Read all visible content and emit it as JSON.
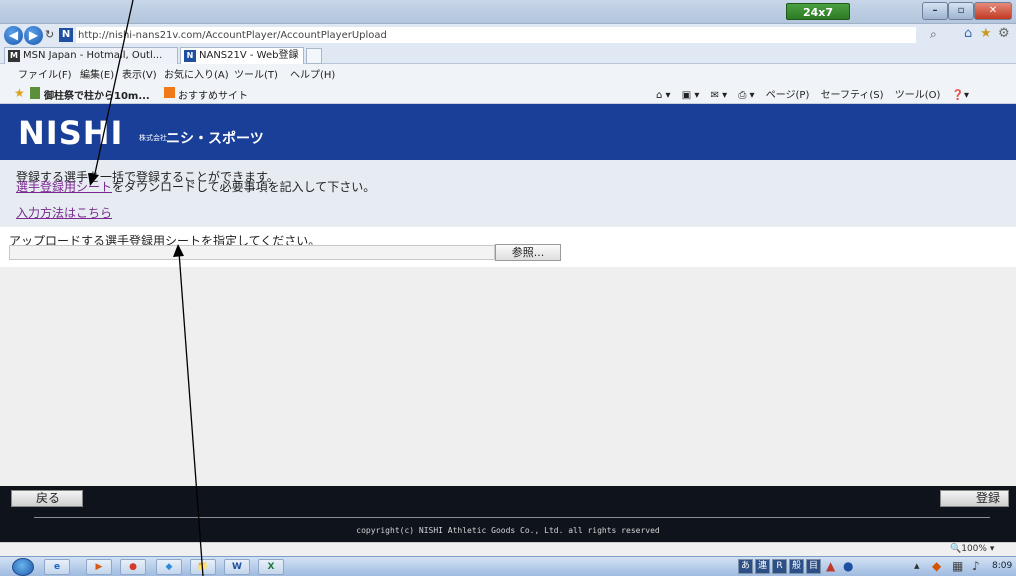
{
  "browser": {
    "help_button": "24x7 Help",
    "window_controls": {
      "minimize": "–",
      "maximize": "▫",
      "close": "✕"
    },
    "address_url": "http://nishi-nans21v.com/AccountPlayer/AccountPlayerUpload",
    "tabs": [
      {
        "label": "MSN Japan - Hotmail, Outl..."
      },
      {
        "label": "NANS21V - Web登録"
      }
    ],
    "tab_close": "×",
    "menu": [
      "ファイル(F)",
      "編集(E)",
      "表示(V)",
      "お気に入り(A)",
      "ツール(T)",
      "ヘルプ(H)"
    ],
    "favorites": [
      "御柱祭で柱から10m...",
      "おすすめサイト"
    ],
    "command_bar": [
      "ページ(P)",
      "セーフティ(S)",
      "ツール(O)"
    ],
    "zoom": "100%"
  },
  "site": {
    "logo": "NISHI",
    "company_prefix": "株式会社",
    "company_name": "ニシ・スポーツ"
  },
  "content": {
    "intro_line1": "登録する選手を一括で登録することができます。",
    "sheet_link": "選手登録用シート",
    "intro_line2_rest": "をダウンロードして必要事項を記入して下さい。",
    "howto_link": "入力方法はこちら",
    "upload_label": "アップロードする選手登録用シートを指定してください。",
    "browse_button": "参照..."
  },
  "footer": {
    "back_button": "戻る",
    "register_button": "登録",
    "copyright": "copyright(c) NISHI Athletic Goods Co., Ltd. all rights reserved"
  },
  "taskbar": {
    "apps": [
      "e",
      "▶",
      "●",
      "◆",
      "📁",
      "W",
      "X"
    ],
    "tray_keys": [
      "あ",
      "連",
      "R",
      "般",
      "目"
    ],
    "clock": "8:09"
  }
}
